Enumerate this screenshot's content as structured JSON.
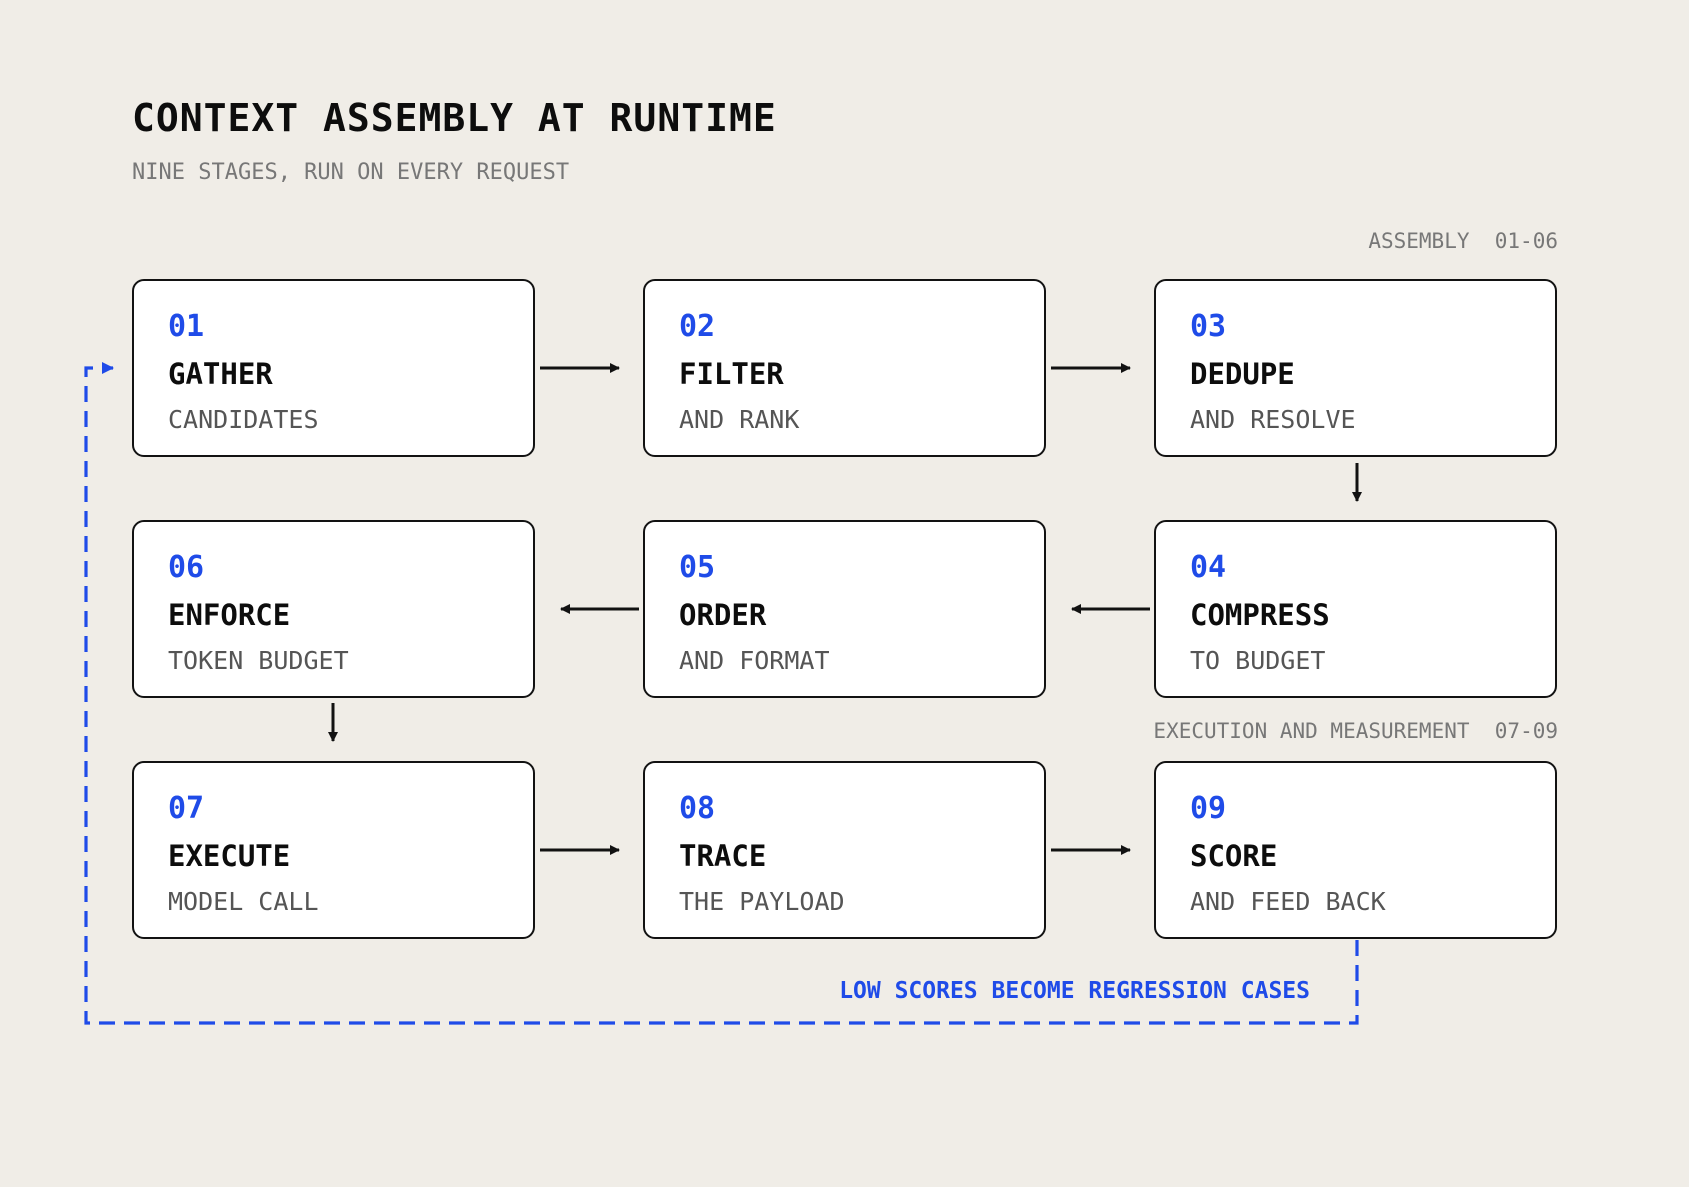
{
  "title": "CONTEXT ASSEMBLY AT RUNTIME",
  "subtitle": "NINE STAGES, RUN ON EVERY REQUEST",
  "sections": {
    "assembly": "ASSEMBLY  01-06",
    "execution": "EXECUTION AND MEASUREMENT  07-09"
  },
  "stages": [
    {
      "num": "01",
      "name": "GATHER",
      "sub": "CANDIDATES"
    },
    {
      "num": "02",
      "name": "FILTER",
      "sub": "AND RANK"
    },
    {
      "num": "03",
      "name": "DEDUPE",
      "sub": "AND RESOLVE"
    },
    {
      "num": "04",
      "name": "COMPRESS",
      "sub": "TO BUDGET"
    },
    {
      "num": "05",
      "name": "ORDER",
      "sub": "AND FORMAT"
    },
    {
      "num": "06",
      "name": "ENFORCE",
      "sub": "TOKEN BUDGET"
    },
    {
      "num": "07",
      "name": "EXECUTE",
      "sub": "MODEL CALL"
    },
    {
      "num": "08",
      "name": "TRACE",
      "sub": "THE PAYLOAD"
    },
    {
      "num": "09",
      "name": "SCORE",
      "sub": "AND FEED BACK"
    }
  ],
  "feedback_label": "LOW SCORES BECOME REGRESSION CASES",
  "colors": {
    "accent": "#1f4be8",
    "ink": "#121212",
    "background": "#f0ede7"
  }
}
